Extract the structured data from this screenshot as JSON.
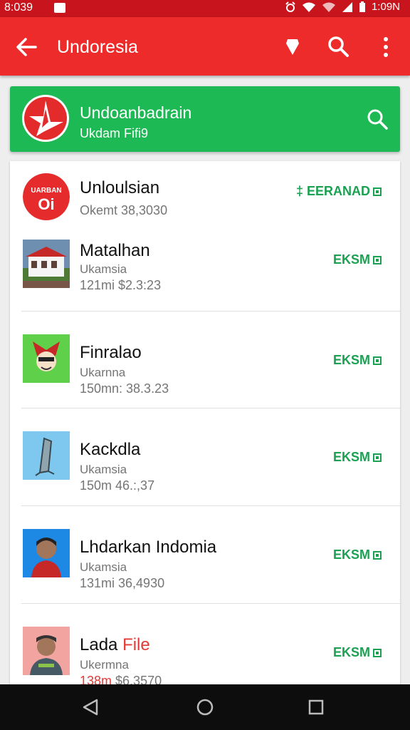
{
  "status_bar": {
    "time": "8:039",
    "clock": "1:09N",
    "icons": [
      "alarm-icon",
      "wifi-icon",
      "signal-icon",
      "battery-icon"
    ]
  },
  "app_bar": {
    "title": "Undoresia",
    "icons": [
      "back-arrow-icon",
      "pin-icon",
      "search-icon",
      "more-vert-icon"
    ]
  },
  "header_card": {
    "name": "Undoanbadrain",
    "subtitle": "Ukdam Fifi9",
    "logo_icon": "red-star-logo-icon",
    "search_icon": "search-icon"
  },
  "items": [
    {
      "title": "Unloulsian",
      "line1": "",
      "line2": "Okemt 38,3030",
      "action": "‡ EERANAD",
      "thumb_icon": "red-logo-thumb"
    },
    {
      "title": "Matalhan",
      "line1": "Ukamsia",
      "line2": "121mi $2.3:23",
      "action": "EKSM",
      "thumb_icon": "house-thumb"
    },
    {
      "title": "Finralao",
      "line1": "Ukarnna",
      "line2": "150mn: 38.3.23",
      "action": "EKSM",
      "thumb_icon": "mask-thumb"
    },
    {
      "title": "Kackdla",
      "line1": "Ukamsia",
      "line2": "150m 46.:,37",
      "action": "EKSM",
      "thumb_icon": "tool-thumb"
    },
    {
      "title": "Lhdarkan Indomia",
      "line1": "Ukamsia",
      "line2": "131mi 36,4930",
      "action": "EKSM",
      "thumb_icon": "person-thumb"
    },
    {
      "title": "Lada ",
      "title_red": "File",
      "line1": "Ukermna",
      "line2_red": "138m",
      "line2": " $6,3570",
      "action": "EKSM",
      "thumb_icon": "person2-thumb"
    }
  ],
  "colors": {
    "app_bar": "#ee2b2b",
    "status_bar": "#c8141c",
    "header_card": "#1db954",
    "action_green": "#1aa152"
  },
  "nav_bar": {
    "icons": [
      "back-triangle-icon",
      "home-circle-icon",
      "recents-square-icon"
    ]
  }
}
